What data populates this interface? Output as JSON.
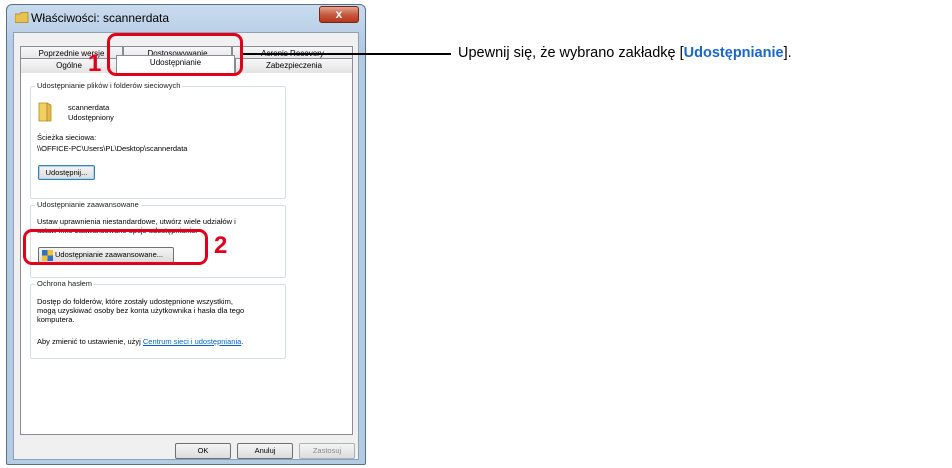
{
  "window": {
    "title": "Właściwości: scannerdata",
    "close_label": "x"
  },
  "tabs_back": [
    "Poprzednie wersje",
    "Dostosowywanie",
    "Acronis Recovery"
  ],
  "tabs_front": [
    "Ogólne",
    "Udostępnianie",
    "Zabezpieczenia"
  ],
  "sharing_group": {
    "title": "Udostępnianie plików i folderów sieciowych",
    "folder_name": "scannerdata",
    "folder_status": "Udostępniony",
    "path_label": "Ścieżka sieciowa:",
    "path_value": "\\\\OFFICE-PC\\Users\\PL\\Desktop\\scannerdata",
    "share_button": "Udostępnij..."
  },
  "advanced_group": {
    "title": "Udostępnianie zaawansowane",
    "description_line1": "Ustaw uprawnienia niestandardowe, utwórz wiele udziałów i",
    "description_line2": "ustaw inne zaawansowane opcje udostępniania.",
    "button": "Udostępnianie zaawansowane..."
  },
  "password_group": {
    "title": "Ochrona hasłem",
    "line1": "Dostęp do folderów, które zostały udostępnione wszystkim,",
    "line2": "mogą uzyskiwać osoby bez konta użytkownika i hasła dla tego",
    "line3": "komputera.",
    "change_prefix": "Aby zmienić to ustawienie, użyj ",
    "link": "Centrum sieci i udostępniania",
    "change_suffix": "."
  },
  "buttons": {
    "ok": "OK",
    "cancel": "Anuluj",
    "apply": "Zastosuj"
  },
  "annotations": {
    "step1": "1",
    "step2": "2",
    "callout_prefix": "Upewnij się, że wybrano zakładkę [",
    "callout_highlight": "Udostępnianie",
    "callout_suffix": "]."
  },
  "colors": {
    "highlight": "#e0001b",
    "callout_accent": "#1a66c9",
    "link": "#0066cc"
  }
}
